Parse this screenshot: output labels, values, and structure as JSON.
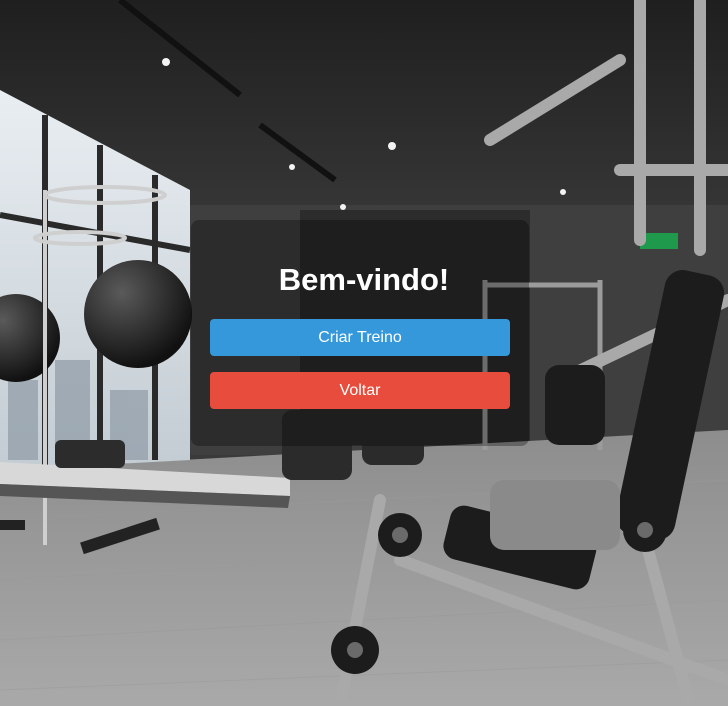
{
  "page": {
    "title": "Bem-vindo!"
  },
  "actions": {
    "create_label": "Criar Treino",
    "back_label": "Voltar"
  },
  "colors": {
    "primary": "#3498db",
    "danger": "#e74c3c",
    "title_text": "#ffffff",
    "overlay": "rgba(0,0,0,0.30)"
  },
  "background": {
    "scene": "gym-interior-photo"
  }
}
